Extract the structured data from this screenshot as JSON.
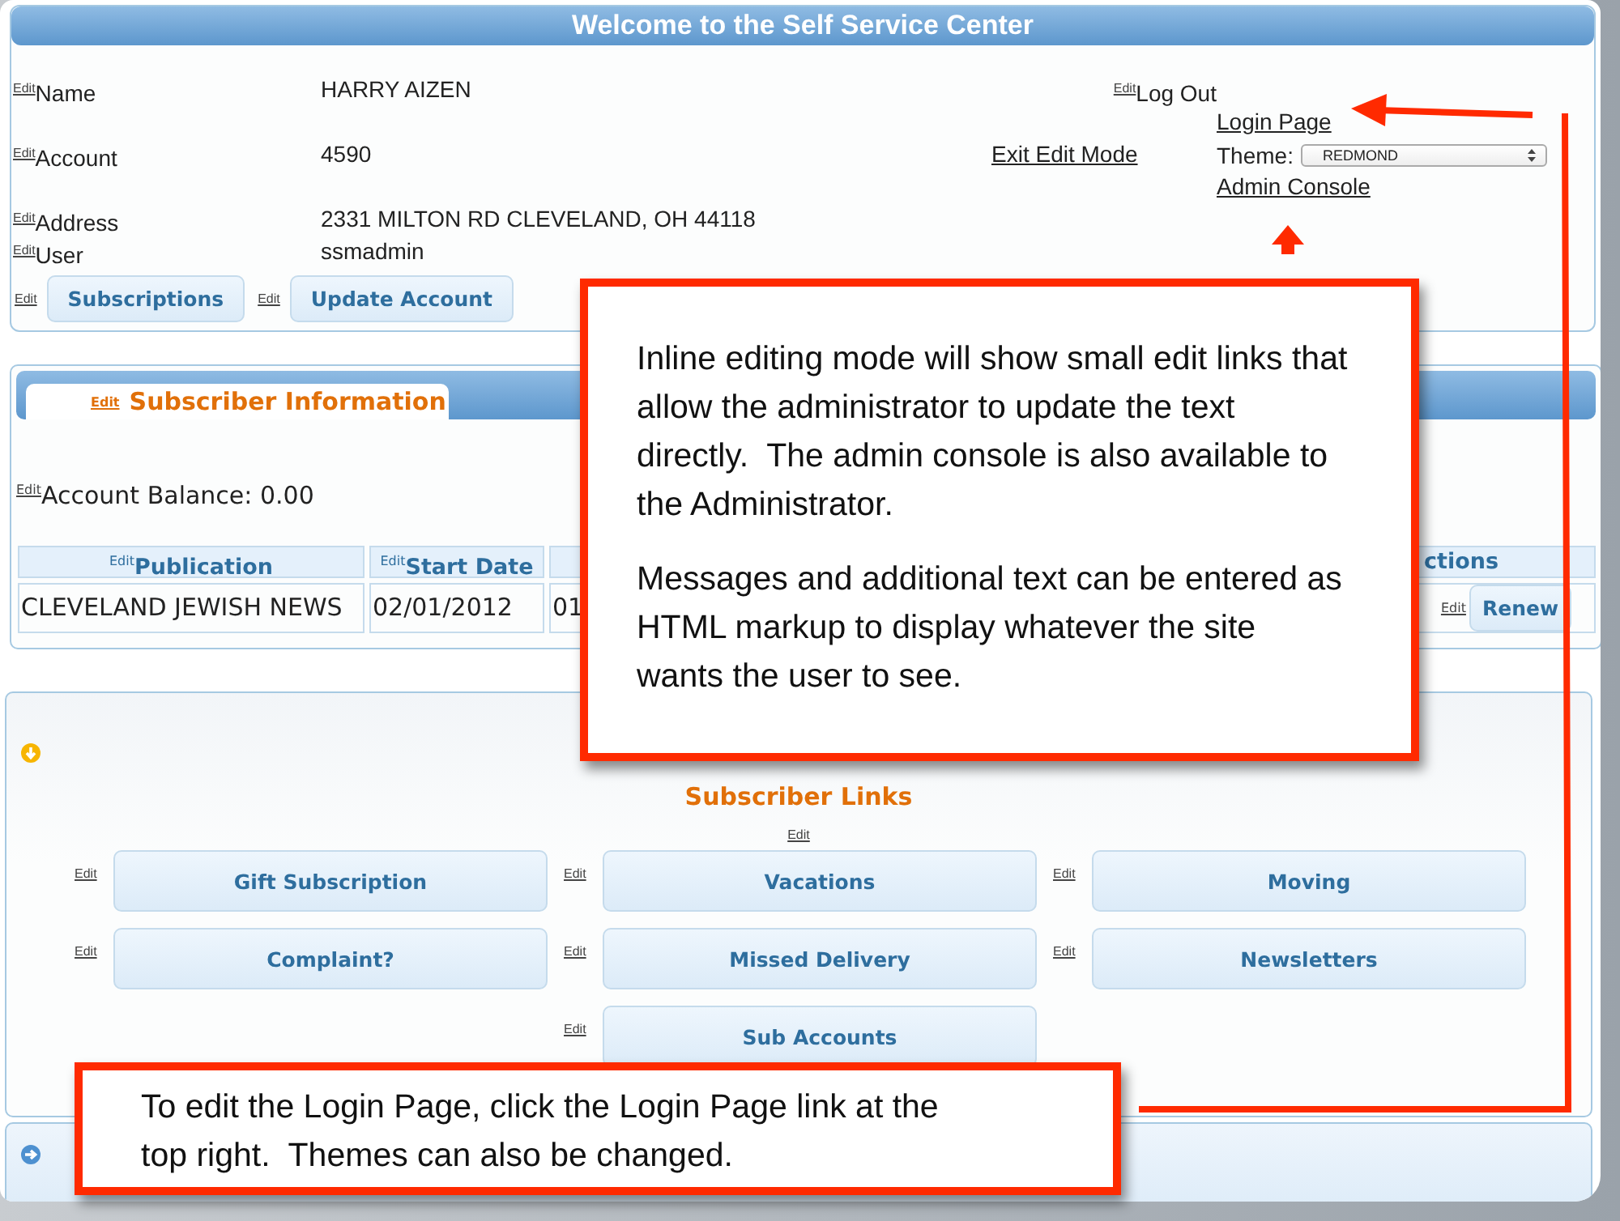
{
  "header": {
    "title": "Welcome to the Self Service Center",
    "fields": [
      {
        "edit_link": "Edit",
        "label": "Name",
        "value": "HARRY AIZEN"
      },
      {
        "edit_link": "Edit",
        "label": "Account",
        "value": "4590"
      },
      {
        "edit_link": "Edit",
        "label": "Address",
        "value": "2331 MILTON RD CLEVELAND, OH 44118"
      },
      {
        "edit_link": "Edit",
        "label": "User",
        "value": "ssmadmin"
      }
    ],
    "log_out": {
      "edit_link": "Edit",
      "label": "Log Out"
    },
    "login_page": "Login Page",
    "exit_edit_mode": "Exit Edit Mode",
    "theme": {
      "label": "Theme:",
      "value": "REDMOND"
    },
    "admin_console": "Admin Console",
    "buttons": [
      {
        "edit_link": "Edit",
        "label": "Subscriptions"
      },
      {
        "edit_link": "Edit",
        "label": "Update Account"
      }
    ]
  },
  "subscriber_info": {
    "tab": {
      "edit_link": "Edit",
      "label": "Subscriber Information",
      "selected": true
    },
    "balance": {
      "edit_link": "Edit",
      "text": "Account Balance: 0.00"
    },
    "table": {
      "columns": [
        {
          "edit_link": "Edit",
          "label": "Publication"
        },
        {
          "edit_link": "Edit",
          "label": "Start Date"
        },
        {},
        {
          "label": "ctions"
        }
      ],
      "rows": [
        {
          "cells": [
            "CLEVELAND JEWISH NEWS",
            "02/01/2012",
            "01"
          ],
          "action": {
            "edit_link": "Edit",
            "button": "Renew"
          }
        }
      ]
    }
  },
  "links": {
    "title": "Subscriber Links",
    "edit_link": "Edit",
    "items": [
      {
        "edit_link": "Edit",
        "label": "Gift Subscription"
      },
      {
        "edit_link": "Edit",
        "label": "Vacations"
      },
      {
        "edit_link": "Edit",
        "label": "Moving"
      },
      {
        "edit_link": "Edit",
        "label": "Complaint?"
      },
      {
        "edit_link": "Edit",
        "label": "Missed Delivery"
      },
      {
        "edit_link": "Edit",
        "label": "Newsletters"
      },
      {
        "edit_link": "Edit",
        "label": "Sub Accounts"
      }
    ]
  },
  "annotations": [
    {
      "paragraphs": [
        "Inline editing mode will show small edit links that allow the administrator to update the text directly.  The admin console is also available to the Administrator.",
        "Messages and additional text can be entered as HTML markup to display whatever the site wants the user to see."
      ]
    },
    {
      "paragraphs": [
        "To edit the Login Page, click the Login Page link at the top right.  Themes can also be changed."
      ]
    }
  ]
}
